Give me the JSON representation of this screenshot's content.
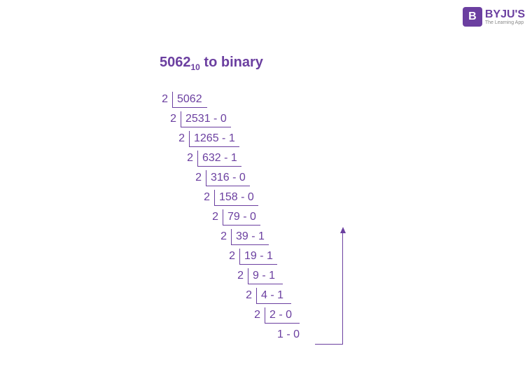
{
  "logo": {
    "badge": "B",
    "main": "BYJU'S",
    "sub": "The Learning App"
  },
  "title": {
    "number": "5062",
    "base": "10",
    "suffix": " to binary"
  },
  "steps": [
    {
      "divisor": "2",
      "value": "5062",
      "indent": 0
    },
    {
      "divisor": "2",
      "value": "2531 - 0",
      "indent": 12
    },
    {
      "divisor": "2",
      "value": "1265 - 1",
      "indent": 24
    },
    {
      "divisor": "2",
      "value": "632 - 1",
      "indent": 36
    },
    {
      "divisor": "2",
      "value": "316 - 0",
      "indent": 48
    },
    {
      "divisor": "2",
      "value": "158 - 0",
      "indent": 60
    },
    {
      "divisor": "2",
      "value": "79 - 0",
      "indent": 72
    },
    {
      "divisor": "2",
      "value": "39 - 1",
      "indent": 84
    },
    {
      "divisor": "2",
      "value": "19 - 1",
      "indent": 96
    },
    {
      "divisor": "2",
      "value": "9 - 1",
      "indent": 108
    },
    {
      "divisor": "2",
      "value": "4 - 1",
      "indent": 120
    },
    {
      "divisor": "2",
      "value": "2 - 0",
      "indent": 132
    },
    {
      "divisor": "",
      "value": "1 - 0",
      "indent": 144
    }
  ]
}
